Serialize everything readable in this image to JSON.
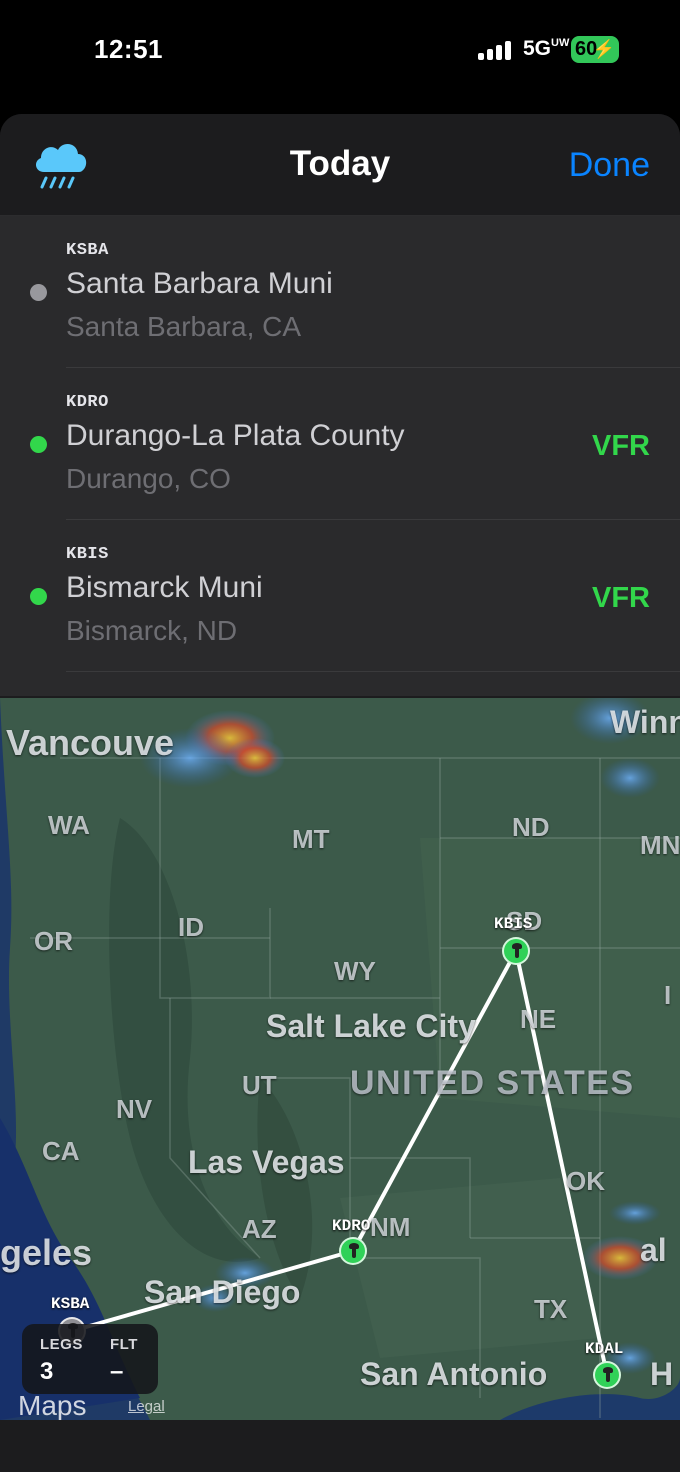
{
  "status_bar": {
    "time": "12:51",
    "network": "5G",
    "network_sub": "UW",
    "battery": "60"
  },
  "header": {
    "title": "Today",
    "done_label": "Done",
    "weather_icon": "cloud-rain-icon"
  },
  "airports": [
    {
      "code": "KSBA",
      "name": "Santa Barbara Muni",
      "city": "Santa Barbara, CA",
      "category": "",
      "dot_color": "#98989d"
    },
    {
      "code": "KDRO",
      "name": "Durango-La Plata County",
      "city": "Durango, CO",
      "category": "VFR",
      "dot_color": "#32d74b"
    },
    {
      "code": "KBIS",
      "name": "Bismarck Muni",
      "city": "Bismarck, ND",
      "category": "VFR",
      "dot_color": "#32d74b"
    }
  ],
  "map": {
    "labels": {
      "vancouver": "Vancouve",
      "winnipeg": "Winn",
      "wa": "WA",
      "mt": "MT",
      "nd": "ND",
      "mn": "MN",
      "or": "OR",
      "id": "ID",
      "sd": "SD",
      "wy": "WY",
      "ia": "I",
      "slc": "Salt Lake City",
      "ne": "NE",
      "ut": "UT",
      "us": "UNITED STATES",
      "nv": "NV",
      "ca": "CA",
      "lv": "Las Vegas",
      "ok": "OK",
      "la": "geles",
      "az": "AZ",
      "nm": "NM",
      "sd_city": "San Diego",
      "dal": "al",
      "tx": "TX",
      "sa": "San Antonio",
      "h": "H"
    },
    "waypoints": [
      {
        "code": "KSBA",
        "color": "#8e8e93"
      },
      {
        "code": "KDRO",
        "color": "#30d158"
      },
      {
        "code": "KBIS",
        "color": "#30d158"
      },
      {
        "code": "KDAL",
        "color": "#30d158"
      }
    ],
    "stats": {
      "legs_label": "LEGS",
      "legs_value": "3",
      "flt_label": "FLT",
      "flt_value": "–"
    },
    "attribution": "Maps",
    "legal": "Legal"
  }
}
